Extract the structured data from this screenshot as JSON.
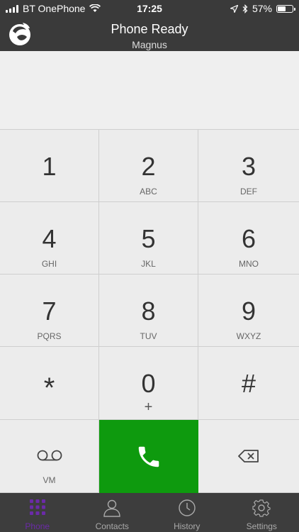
{
  "status_bar": {
    "carrier": "BT OnePhone",
    "time": "17:25",
    "battery": "57%",
    "battery_level": 0.57
  },
  "header": {
    "title": "Phone Ready",
    "subtitle": "Magnus"
  },
  "display": {
    "value": ""
  },
  "keypad": {
    "keys": [
      {
        "digit": "1",
        "letters": ""
      },
      {
        "digit": "2",
        "letters": "ABC"
      },
      {
        "digit": "3",
        "letters": "DEF"
      },
      {
        "digit": "4",
        "letters": "GHI"
      },
      {
        "digit": "5",
        "letters": "JKL"
      },
      {
        "digit": "6",
        "letters": "MNO"
      },
      {
        "digit": "7",
        "letters": "PQRS"
      },
      {
        "digit": "8",
        "letters": "TUV"
      },
      {
        "digit": "9",
        "letters": "WXYZ"
      },
      {
        "digit": "*",
        "letters": ""
      },
      {
        "digit": "0",
        "letters": "+"
      },
      {
        "digit": "#",
        "letters": ""
      }
    ],
    "vm_label": "VM"
  },
  "tabs": [
    {
      "label": "Phone",
      "icon": "keypad-grid-icon",
      "active": true
    },
    {
      "label": "Contacts",
      "icon": "person-icon",
      "active": false
    },
    {
      "label": "History",
      "icon": "clock-icon",
      "active": false
    },
    {
      "label": "Settings",
      "icon": "gear-icon",
      "active": false
    }
  ],
  "colors": {
    "header_bg": "#3a3a3a",
    "call_green": "#0e9a0e",
    "active_tab": "#6b2aa8"
  }
}
